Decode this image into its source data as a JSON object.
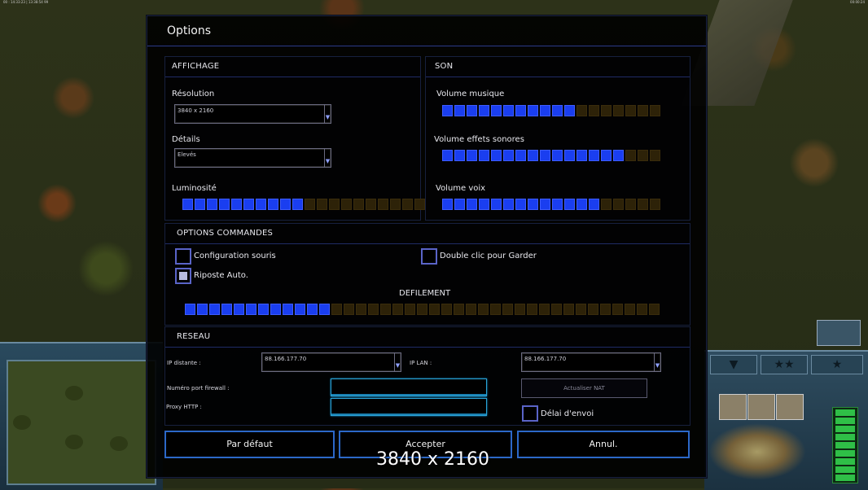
{
  "topbar": {
    "left_text": "00 : 14:33:23 | 13:38:54 99",
    "right_text": "00:00:24"
  },
  "dialog": {
    "title": "Options",
    "display": {
      "header": "AFFICHAGE",
      "resolution_label": "Résolution",
      "resolution_value": "3840 x 2160",
      "details_label": "Détails",
      "details_value": "Elevés",
      "brightness_label": "Luminosité",
      "brightness_level": 10,
      "brightness_segments": 20
    },
    "sound": {
      "header": "SON",
      "music_label": "Volume musique",
      "music_level": 11,
      "music_segments": 18,
      "sfx_label": "Volume effets sonores",
      "sfx_level": 15,
      "sfx_segments": 18,
      "voice_label": "Volume voix",
      "voice_level": 13,
      "voice_segments": 18
    },
    "controls": {
      "header": "OPTIONS COMMANDES",
      "mouse_config_label": "Configuration souris",
      "mouse_config_checked": false,
      "double_click_label": "Double clic pour Garder",
      "double_click_checked": false,
      "auto_retaliate_label": "Riposte Auto.",
      "auto_retaliate_checked": true,
      "scroll_label": "DEFILEMENT",
      "scroll_level": 12,
      "scroll_segments": 39
    },
    "network": {
      "header": "RESEAU",
      "remote_ip_label": "IP distante :",
      "remote_ip_value": "88.166.177.70",
      "lan_ip_label": "IP LAN :",
      "lan_ip_value": "88.166.177.70",
      "firewall_port_label": "Numéro port firewall :",
      "firewall_port_value": "",
      "proxy_label": "Proxy HTTP :",
      "proxy_value": "",
      "update_nat_label": "Actualiser NAT",
      "send_delay_label": "Délai d'envoi",
      "send_delay_checked": false
    },
    "buttons": {
      "default": "Par défaut",
      "accept": "Accepter",
      "cancel": "Annul."
    }
  },
  "overlay": {
    "resolution_text": "3840 x 2160"
  },
  "colors": {
    "slider_on": "#1a3ef0",
    "slider_off": "#2d2208",
    "button_border": "#2c68c8",
    "field_border": "#2aa4d8"
  }
}
